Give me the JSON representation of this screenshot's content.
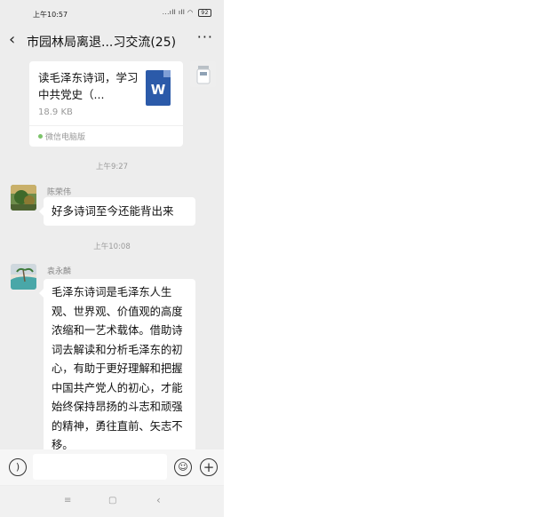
{
  "status_bar": {
    "time": "上午10:57",
    "signal": "...ıll ıll",
    "battery": "92"
  },
  "header": {
    "back_glyph": "‹",
    "title": "市园林局离退...习交流(25)",
    "more_glyph": "···"
  },
  "messages": [
    {
      "type": "file",
      "file_name": "读毛泽东诗词，学习中共党史（...",
      "file_size": "18.9 KB",
      "file_icon_letter": "W",
      "source": "微信电脑版"
    },
    {
      "type": "time",
      "text": "上午9:27"
    },
    {
      "type": "text",
      "sender": "陈荣伟",
      "text": "好多诗词至今还能背出来"
    },
    {
      "type": "time",
      "text": "上午10:08"
    },
    {
      "type": "text",
      "sender": "袁永麟",
      "text": "毛泽东诗词是毛泽东人生观、世界观、价值观的高度浓缩和一艺术载体。借助诗词去解读和分析毛泽东的初心，有助于更好理解和把握中国共产党人的初心，才能始终保持昂扬的斗志和顽强的精神，勇往直前、矢志不移。"
    }
  ],
  "input_bar": {
    "voice_icon": "voice-icon",
    "emoji_icon": "emoji-icon",
    "plus_icon": "plus-icon"
  },
  "system_nav": {
    "menu": "≡",
    "home": "▢",
    "back": "‹"
  },
  "colors": {
    "chat_bg": "#ededed",
    "bubble_bg": "#ffffff",
    "word_blue": "#2b5aa9",
    "source_dot": "#7cc36a"
  }
}
